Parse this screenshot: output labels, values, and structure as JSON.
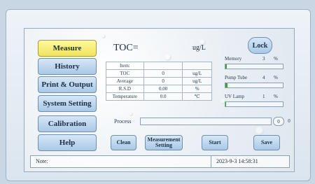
{
  "header": {
    "toc_label": "TOC=",
    "toc_value": "",
    "toc_unit": "ug/L",
    "lock_label": "Lock"
  },
  "sidebar": {
    "items": [
      {
        "label": "Measure",
        "active": true
      },
      {
        "label": "History",
        "active": false
      },
      {
        "label": "Print & Output",
        "active": false
      },
      {
        "label": "System Setting",
        "active": false
      },
      {
        "label": "Calibration",
        "active": false
      },
      {
        "label": "Help",
        "active": false
      }
    ]
  },
  "table": {
    "header": "Item:",
    "rows": [
      {
        "name": "TOC",
        "value": "0",
        "unit": "ug/L"
      },
      {
        "name": "Average",
        "value": "0",
        "unit": "ug/L"
      },
      {
        "name": "R.S.D",
        "value": "0.00",
        "unit": "%"
      },
      {
        "name": "Temperature",
        "value": "0.0",
        "unit": "℃"
      }
    ]
  },
  "stats": [
    {
      "label": "Memory",
      "value": "3",
      "unit": "%",
      "fraction": 0.03
    },
    {
      "label": "Pump Tube",
      "value": "4",
      "unit": "%",
      "fraction": 0.04
    },
    {
      "label": "UV Lamp",
      "value": "1",
      "unit": "%",
      "fraction": 0.01
    }
  ],
  "process": {
    "label": "Process",
    "fraction": 0.0,
    "num1": "0",
    "num2": "0"
  },
  "actions": {
    "clean": "Clean",
    "measurement_setting_line1": "Measurement",
    "measurement_setting_line2": "Setting",
    "start": "Start",
    "save": "Save"
  },
  "status": {
    "note_label": "Note:",
    "datetime": "2023-9-3  14:58:31"
  },
  "colors": {
    "active_button": "#f2e35c",
    "button": "#a9c8e6",
    "progress_fill": "#3fa33b"
  }
}
